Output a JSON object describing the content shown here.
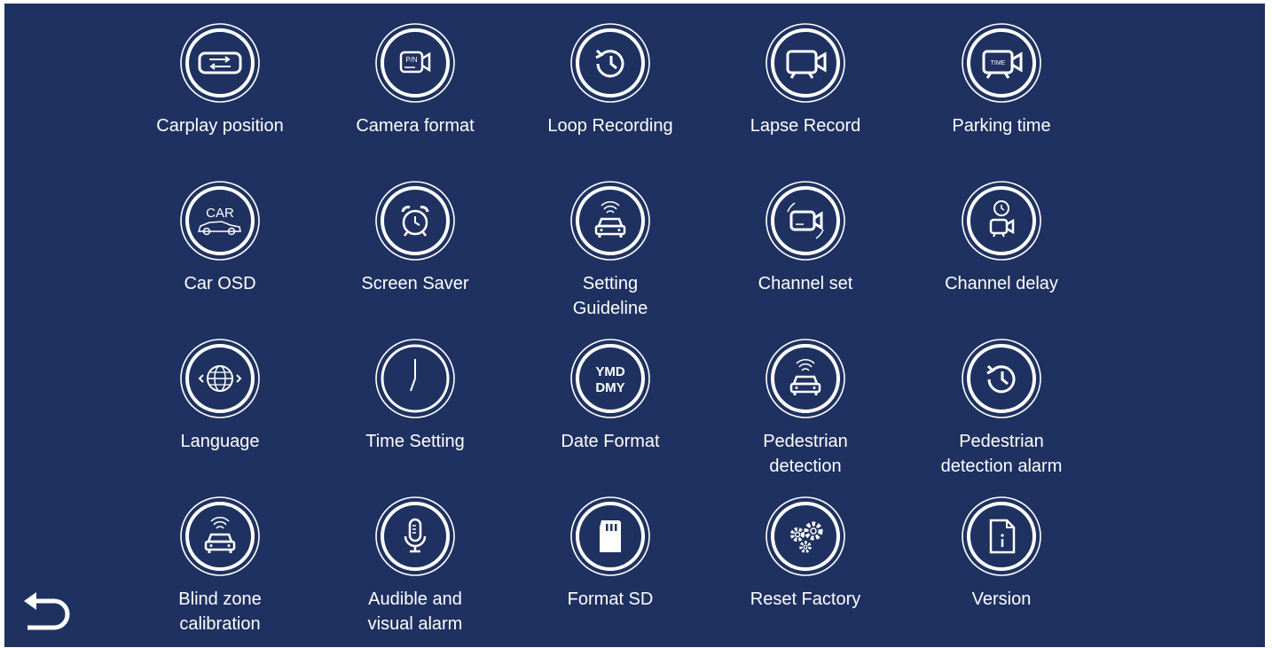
{
  "colors": {
    "background": "#1f3160",
    "foreground": "#ffffff"
  },
  "items": [
    {
      "label": "Carplay position",
      "icon": "carplay-position-icon"
    },
    {
      "label": "Camera format",
      "icon": "camera-format-icon"
    },
    {
      "label": "Loop Recording",
      "icon": "loop-recording-icon"
    },
    {
      "label": "Lapse Record",
      "icon": "lapse-record-icon"
    },
    {
      "label": "Parking time",
      "icon": "parking-time-icon"
    },
    {
      "label": "Car OSD",
      "icon": "car-osd-icon"
    },
    {
      "label": "Screen Saver",
      "icon": "alarm-clock-icon"
    },
    {
      "label": "Setting\nGuideline",
      "icon": "car-signal-icon"
    },
    {
      "label": "Channel set",
      "icon": "channel-camera-icon"
    },
    {
      "label": "Channel delay",
      "icon": "clock-camera-icon"
    },
    {
      "label": "Language",
      "icon": "globe-icon"
    },
    {
      "label": "Time Setting",
      "icon": "clock-icon"
    },
    {
      "label": "Date Format",
      "icon": "date-format-icon"
    },
    {
      "label": "Pedestrian\ndetection",
      "icon": "car-signal-icon"
    },
    {
      "label": "Pedestrian\ndetection alarm",
      "icon": "history-icon"
    },
    {
      "label": "Blind zone\ncalibration",
      "icon": "car-signal-icon"
    },
    {
      "label": "Audible and\nvisual alarm",
      "icon": "microphone-icon"
    },
    {
      "label": "Format SD",
      "icon": "sd-card-icon"
    },
    {
      "label": "Reset Factory",
      "icon": "gears-icon"
    },
    {
      "label": "Version",
      "icon": "document-info-icon"
    }
  ],
  "icon_text": {
    "pn": "P/N",
    "time": "TIME",
    "car": "CAR",
    "ymd": "YMD",
    "dmy": "DMY"
  },
  "back": {
    "icon": "back-arrow-icon"
  }
}
